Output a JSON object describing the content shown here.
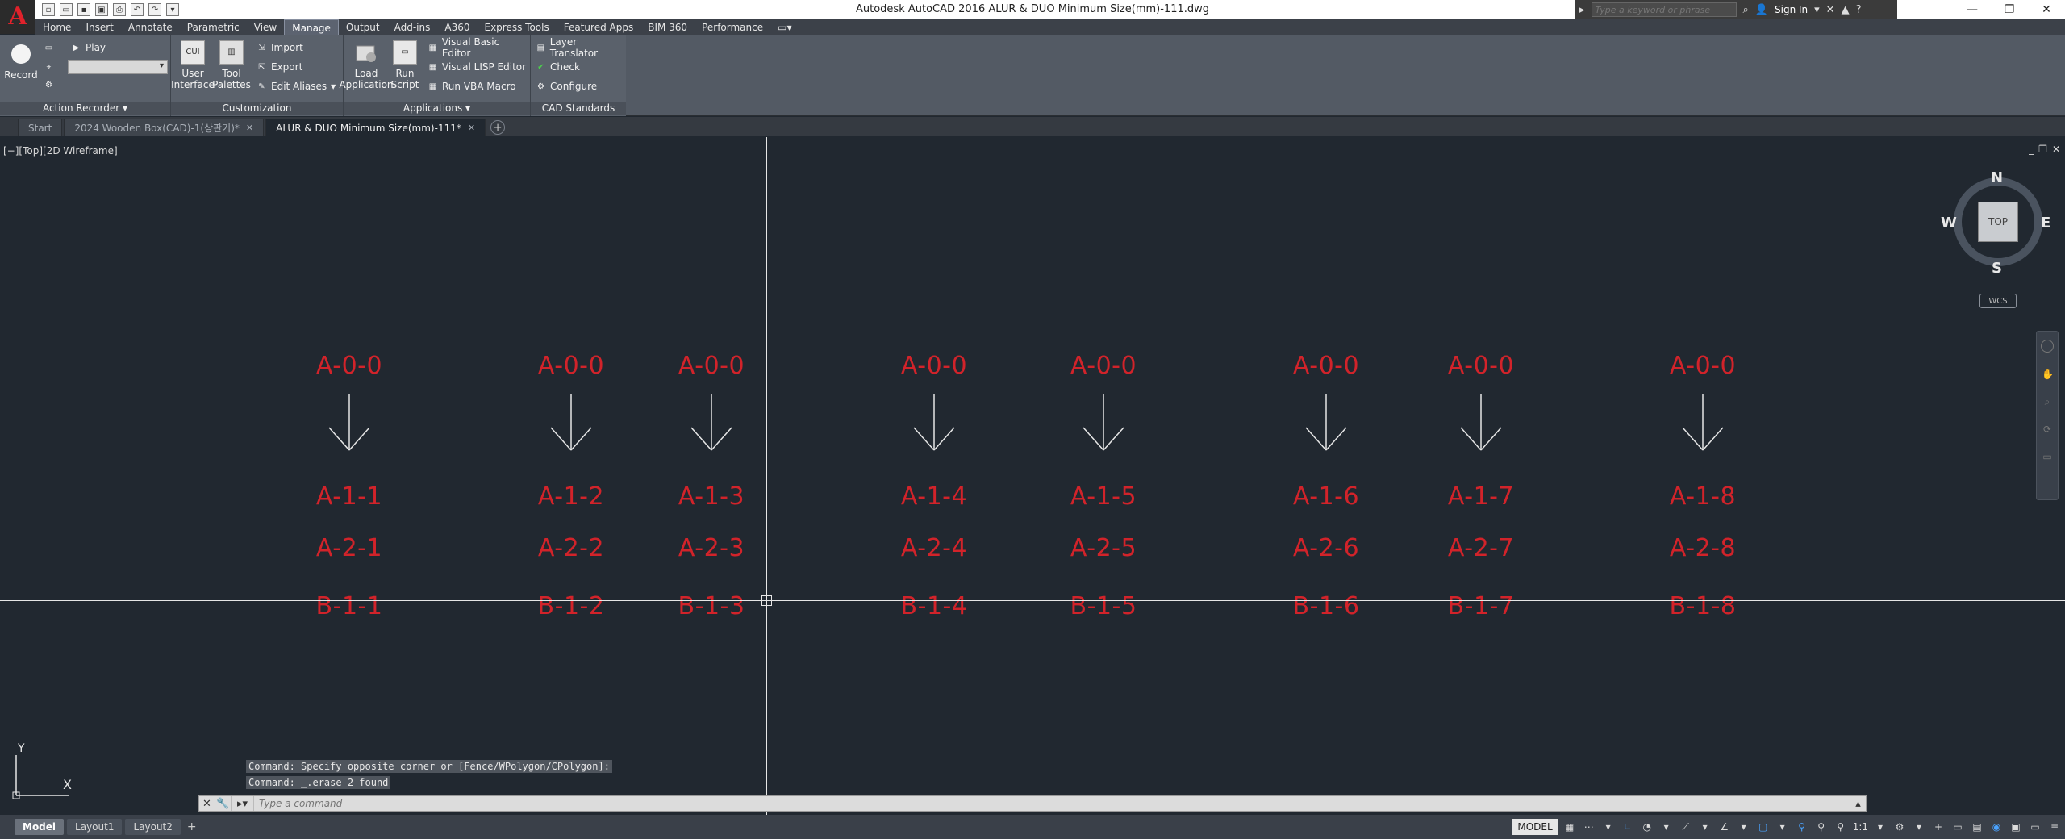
{
  "app": {
    "window_title": "Autodesk AutoCAD 2016    ALUR & DUO Minimum Size(mm)-111.dwg",
    "search_placeholder": "Type a keyword or phrase",
    "sign_in": "Sign In"
  },
  "ribbon_tabs": [
    "Home",
    "Insert",
    "Annotate",
    "Parametric",
    "View",
    "Manage",
    "Output",
    "Add-ins",
    "A360",
    "Express Tools",
    "Featured Apps",
    "BIM 360",
    "Performance"
  ],
  "active_ribbon_tab": "Manage",
  "ribbon": {
    "action_recorder": {
      "record": "Record",
      "play": "Play",
      "title": "Action Recorder"
    },
    "customization": {
      "user_interface_1": "User",
      "user_interface_2": "Interface",
      "tool_palettes_1": "Tool",
      "tool_palettes_2": "Palettes",
      "import": "Import",
      "export": "Export",
      "edit_aliases": "Edit Aliases",
      "title": "Customization"
    },
    "applications": {
      "load_app_1": "Load",
      "load_app_2": "Application",
      "run_script_1": "Run",
      "run_script_2": "Script",
      "vba_editor": "Visual Basic Editor",
      "lisp_editor": "Visual LISP Editor",
      "run_vba": "Run VBA Macro",
      "title": "Applications"
    },
    "cad_standards": {
      "layer_translator": "Layer Translator",
      "check": "Check",
      "configure": "Configure",
      "title": "CAD Standards"
    }
  },
  "doc_tabs": [
    {
      "label": "Start"
    },
    {
      "label": "2024 Wooden Box(CAD)-1(상판기)*"
    },
    {
      "label": "ALUR & DUO Minimum Size(mm)-111*"
    }
  ],
  "viewport": {
    "label": "[−][Top][2D Wireframe]",
    "viewcube": {
      "n": "N",
      "s": "S",
      "e": "E",
      "w": "W",
      "face": "TOP",
      "wcs": "WCS"
    }
  },
  "drawing": {
    "columns": [
      {
        "top": "A-0-0",
        "r1": "A-1-1",
        "r2": "A-2-1",
        "r3": "B-1-1"
      },
      {
        "top": "A-0-0",
        "r1": "A-1-2",
        "r2": "A-2-2",
        "r3": "B-1-2"
      },
      {
        "top": "A-0-0",
        "r1": "A-1-3",
        "r2": "A-2-3",
        "r3": "B-1-3"
      },
      {
        "top": "A-0-0",
        "r1": "A-1-4",
        "r2": "A-2-4",
        "r3": "B-1-4"
      },
      {
        "top": "A-0-0",
        "r1": "A-1-5",
        "r2": "A-2-5",
        "r3": "B-1-5"
      },
      {
        "top": "A-0-0",
        "r1": "A-1-6",
        "r2": "A-2-6",
        "r3": "B-1-6"
      },
      {
        "top": "A-0-0",
        "r1": "A-1-7",
        "r2": "A-2-7",
        "r3": "B-1-7"
      },
      {
        "top": "A-0-0",
        "r1": "A-1-8",
        "r2": "A-2-8",
        "r3": "B-1-8"
      }
    ]
  },
  "ucs": {
    "x": "X",
    "y": "Y"
  },
  "command": {
    "history": [
      "Command: Specify opposite corner or [Fence/WPolygon/CPolygon]:",
      "Command: _.erase 2 found"
    ],
    "placeholder": "Type a command"
  },
  "layout_tabs": [
    "Model",
    "Layout1",
    "Layout2"
  ],
  "status": {
    "model": "MODEL",
    "scale": "1:1"
  },
  "colors": {
    "canvas": "#212830",
    "cad_text": "#d2232a",
    "ribbon": "#5a616b"
  }
}
